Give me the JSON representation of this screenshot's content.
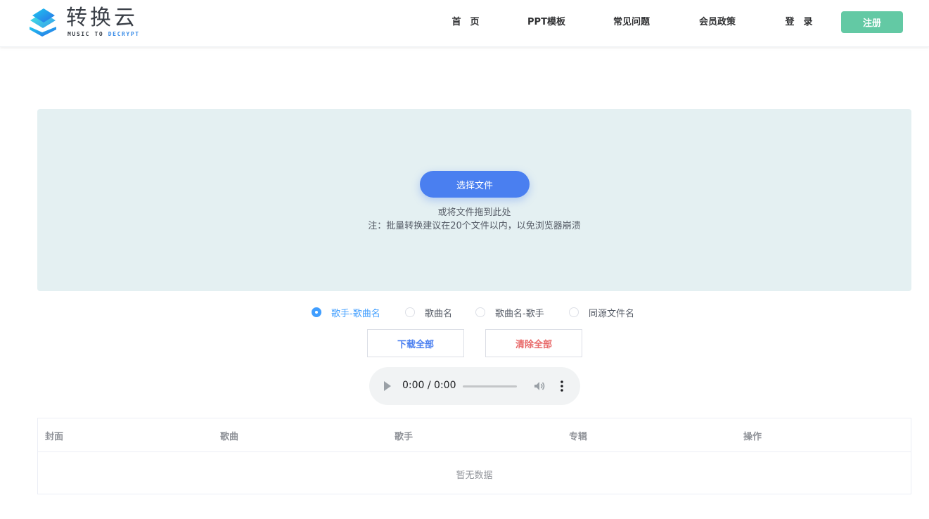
{
  "logo": {
    "title": "转换云",
    "subtitle_part1": "MUSIC TO ",
    "subtitle_part2": "DECRYPT"
  },
  "nav": {
    "home": "首　页",
    "ppt": "PPT模板",
    "faq": "常见问题",
    "vip": "会员政策",
    "login": "登　录",
    "register": "注册"
  },
  "upload": {
    "choose_button": "选择文件",
    "drop_hint": "或将文件拖到此处",
    "batch_note": "注：批量转换建议在20个文件以内，以免浏览器崩溃"
  },
  "naming": {
    "options": [
      {
        "label": "歌手-歌曲名",
        "checked": true
      },
      {
        "label": "歌曲名",
        "checked": false
      },
      {
        "label": "歌曲名-歌手",
        "checked": false
      },
      {
        "label": "同源文件名",
        "checked": false
      }
    ]
  },
  "actions": {
    "download_all": "下载全部",
    "clear_all": "清除全部"
  },
  "player": {
    "time": "0:00 / 0:00"
  },
  "table": {
    "headers": [
      "封面",
      "歌曲",
      "歌手",
      "专辑",
      "操作"
    ],
    "empty_text": "暂无数据"
  },
  "colors": {
    "register_green": "#63c9a4",
    "primary_blue": "#4a7ff0",
    "danger_red": "#e86a6a",
    "upload_bg": "#e4f0f2"
  }
}
